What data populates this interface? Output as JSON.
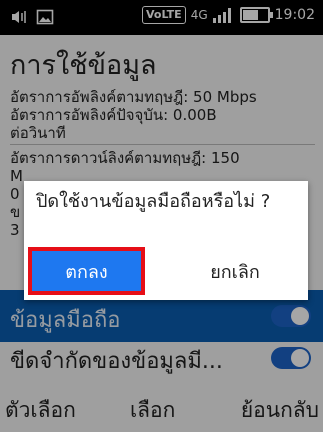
{
  "status_bar": {
    "left_icons": [
      "volume-vibrate-icon",
      "image-icon"
    ],
    "volte": "VoLTE",
    "network": "4G",
    "signal_icon": "signal-icon",
    "battery_icon": "battery-icon",
    "time": "19:02"
  },
  "page": {
    "title": "การใช้ข้อมูล"
  },
  "content": {
    "lines": [
      "อัตราการอัพลิงค์ตามทฤษฎี: 50 Mbps",
      "อัตราการอัพลิงค์ปัจจุบัน: 0.00B",
      "ต่อวินาที",
      "อัตราการดาวน์ลิงค์ตามทฤษฎี: 150"
    ],
    "partial_lines": [
      "M",
      "0",
      "ข",
      "3"
    ]
  },
  "rows": {
    "mobile_data_label": "ข้อมูลมือถือ",
    "data_limit_label": "ขีดจำกัดของข้อมูลมี...",
    "data_limit_toggle_on": true
  },
  "dialog": {
    "message": "ปิดใช้งานข้อมูลมือถือหรือไม่ ?",
    "ok_label": "ตกลง",
    "cancel_label": "ยกเลิก",
    "highlight_color": "#e60e17",
    "ok_bg_color": "#1e78f0"
  },
  "softkeys": {
    "left": "ตัวเลือก",
    "center": "เลือก",
    "right": "ย้อนกลับ"
  }
}
